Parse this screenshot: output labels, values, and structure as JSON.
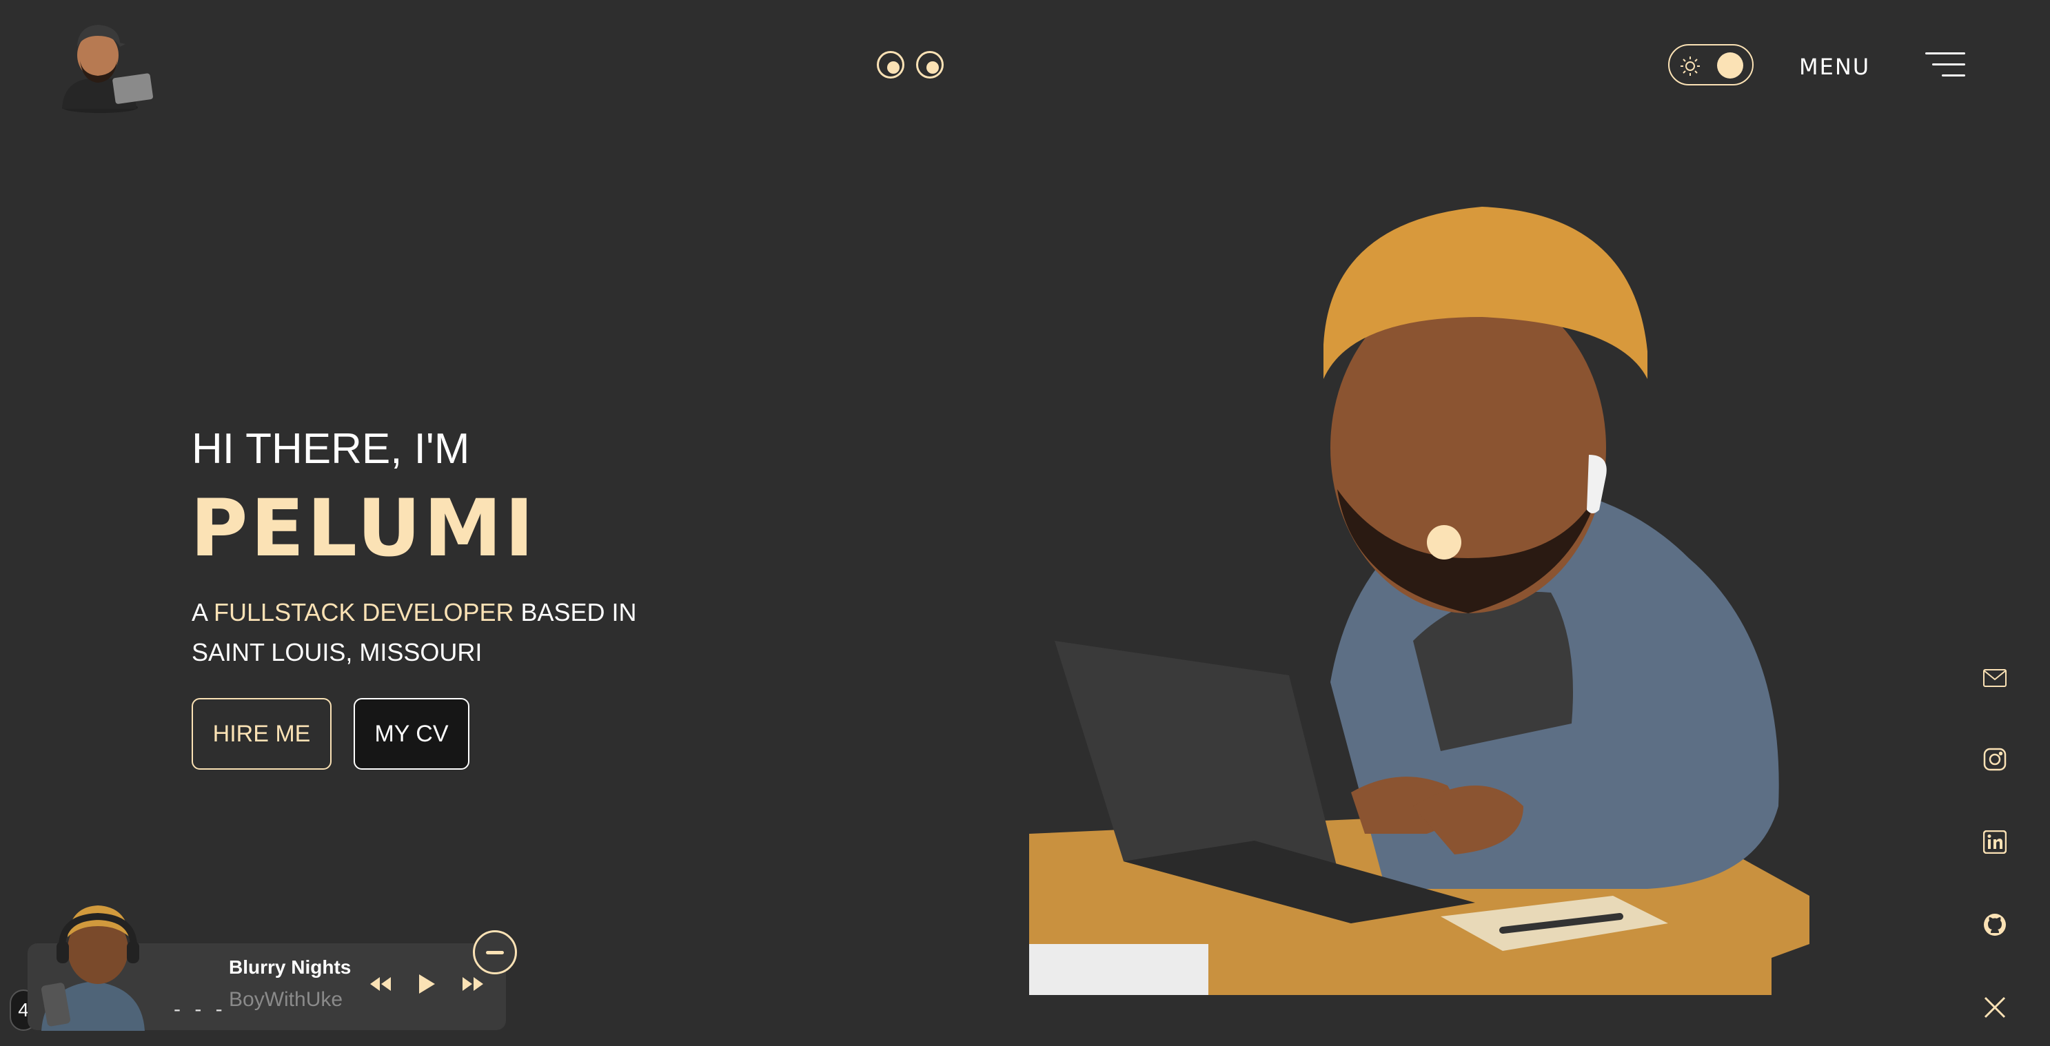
{
  "header": {
    "menu_label": "MENU"
  },
  "hero": {
    "greeting": "HI THERE, I'M",
    "name": "PELUMI",
    "tagline_prefix": "A ",
    "tagline_highlight": "FULLSTACK DEVELOPER",
    "tagline_suffix": " BASED IN SAINT LOUIS, MISSOURI",
    "hire_button": "HIRE ME",
    "cv_button": "MY CV"
  },
  "socials": [
    "mail-icon",
    "instagram-icon",
    "linkedin-icon",
    "github-icon",
    "x-icon"
  ],
  "player": {
    "title": "Blurry Nights",
    "artist": "BoyWithUke",
    "progress_placeholder": "- - -",
    "edge_badge": "4"
  },
  "colors": {
    "background": "#2e2e2e",
    "accent": "#fbe2b5",
    "player_bg": "#3b3b3b"
  }
}
